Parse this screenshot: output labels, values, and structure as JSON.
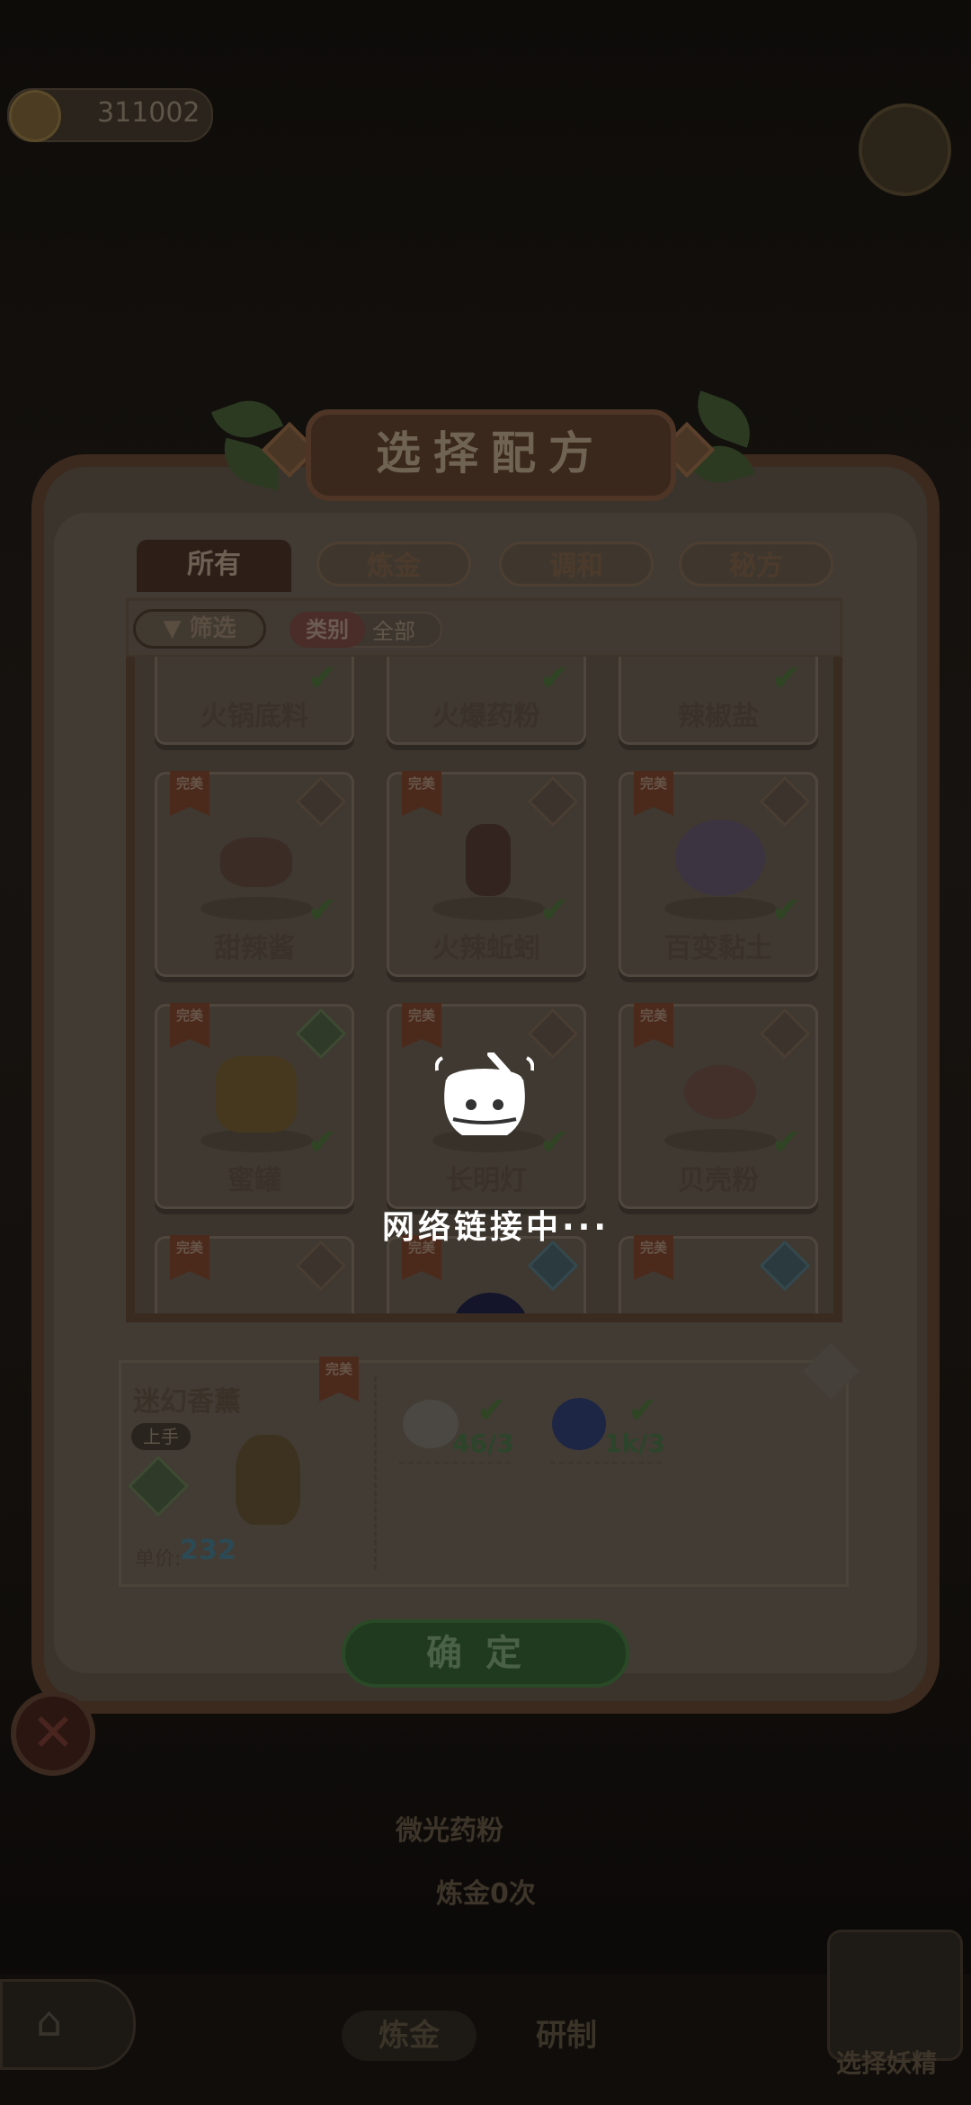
{
  "header": {
    "coins": "311002"
  },
  "dialog": {
    "title": "选择配方",
    "tabs": [
      "所有",
      "炼金",
      "调和",
      "秘方"
    ],
    "filter_label": "筛选",
    "category_label": "类别",
    "category_value": "全部",
    "recipes": [
      {
        "name": "火锅底料",
        "perfect": false,
        "checked": true
      },
      {
        "name": "火爆药粉",
        "perfect": false,
        "checked": true
      },
      {
        "name": "辣椒盐",
        "perfect": false,
        "checked": true
      },
      {
        "name": "甜辣酱",
        "perfect": true,
        "checked": true
      },
      {
        "name": "火辣蚯蚓",
        "perfect": true,
        "checked": true
      },
      {
        "name": "百变黏土",
        "perfect": true,
        "checked": true
      },
      {
        "name": "蜜罐",
        "perfect": true,
        "checked": true
      },
      {
        "name": "长明灯",
        "perfect": true,
        "checked": true
      },
      {
        "name": "贝壳粉",
        "perfect": true,
        "checked": true
      },
      {
        "name": "",
        "perfect": true,
        "checked": false
      },
      {
        "name": "",
        "perfect": true,
        "checked": false
      },
      {
        "name": "",
        "perfect": true,
        "checked": false
      }
    ],
    "perfect_tag": "完美",
    "selected": {
      "name": "迷幻香薰",
      "tag": "上手",
      "perfect": "完美",
      "price_label": "单价:",
      "price": "232",
      "materials": [
        {
          "qty": "46/3"
        },
        {
          "qty": "1k/3"
        }
      ]
    },
    "confirm": "确定"
  },
  "background": {
    "potion_name": "微光药粉",
    "alchemy_count": "炼金0次",
    "bottom_tabs": [
      "炼金",
      "研制"
    ],
    "pick_demon": "选择妖精"
  },
  "loading": {
    "text": "网络链接中···"
  }
}
